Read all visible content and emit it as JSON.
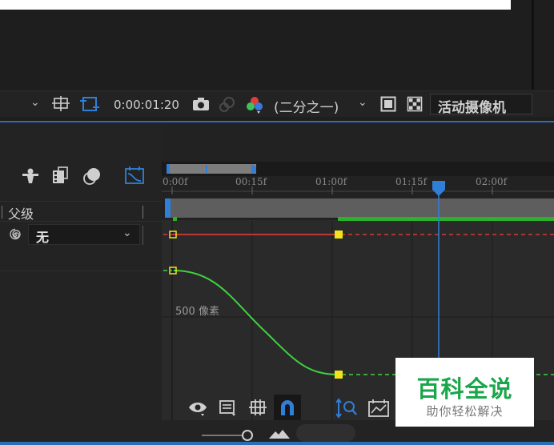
{
  "viewer": {
    "timecode": "0:00:01:20",
    "resolution": "(二分之一)",
    "camera": "活动摄像机"
  },
  "layer_panel": {
    "parent_header": "父级",
    "parent_value": "无"
  },
  "ruler": {
    "ticks": [
      "0:00f",
      "00:15f",
      "01:00f",
      "01:15f",
      "02:00f"
    ]
  },
  "graph": {
    "value_label": "500 像素"
  },
  "watermark": {
    "title": "百科全说",
    "subtitle": "助你轻松解决"
  },
  "colors": {
    "accent_blue": "#2f7fd8",
    "curve_green": "#3ed23e",
    "curve_red": "#d23a3a",
    "keyframe_yellow": "#f2e21a",
    "watermark_green": "#1aa64a"
  },
  "icons": [
    "chevron-down-icon",
    "grid-target-icon",
    "region-of-interest-icon",
    "camera-snapshot-icon",
    "show-snapshot-icon",
    "color-channels-icon",
    "fast-preview-icon",
    "transparency-grid-icon",
    "shy-layer-icon",
    "frame-blending-icon",
    "motion-blur-icon",
    "graph-editor-icon",
    "spiral-pickwhip-icon",
    "eye-icon",
    "list-icon",
    "snap-grid-icon",
    "magnet-icon",
    "zoom-fit-icon",
    "frame-icon"
  ]
}
